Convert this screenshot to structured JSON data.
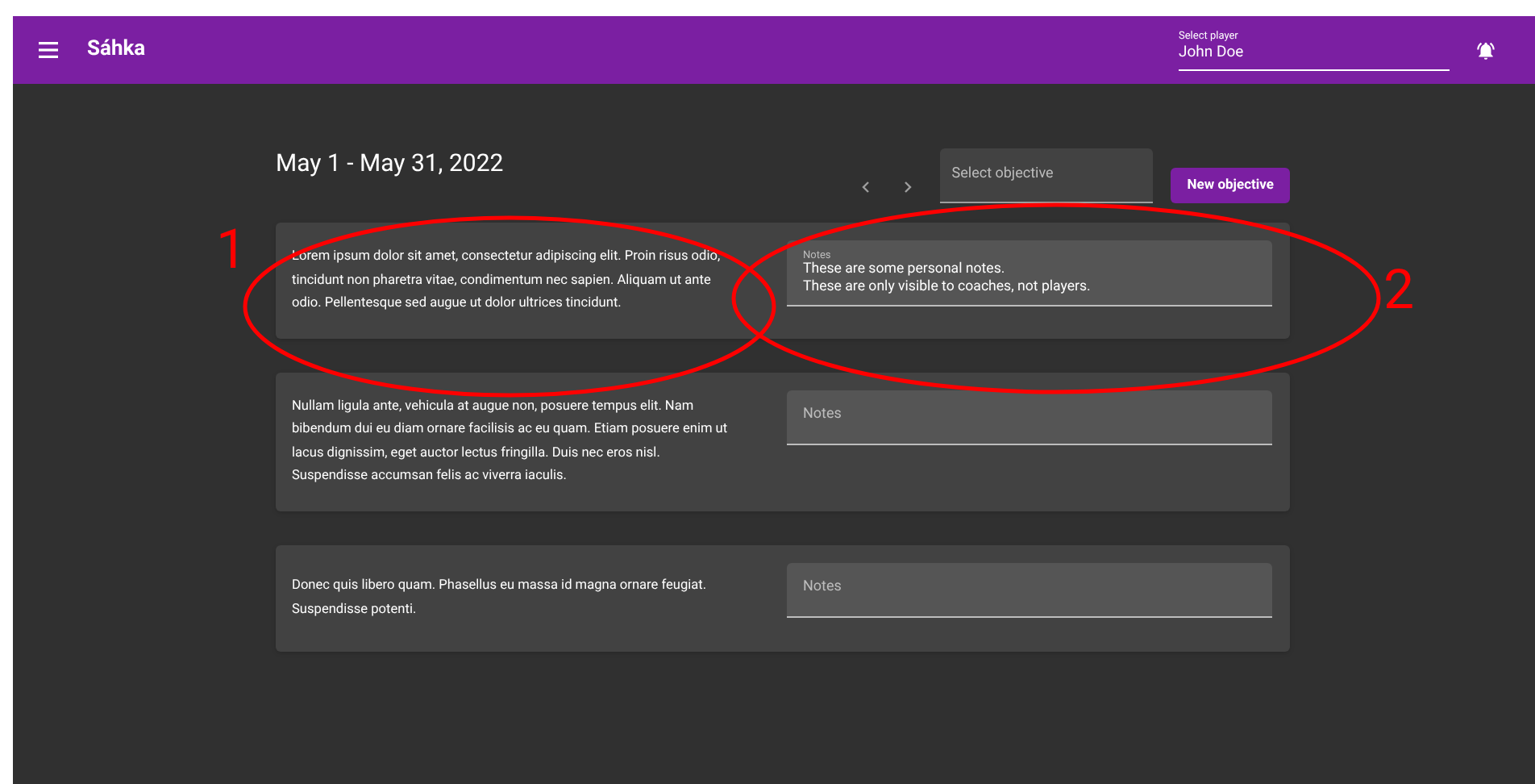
{
  "app_bar": {
    "title": "Sáhka",
    "player_select": {
      "label": "Select player",
      "value": "John Doe"
    }
  },
  "toolbar": {
    "date_range": "May 1 - May 31, 2022",
    "objective_select": {
      "placeholder": "Select objective"
    },
    "new_button": "New objective"
  },
  "objectives": [
    {
      "text": "Lorem ipsum dolor sit amet, consectetur adipiscing elit. Proin risus odio, tincidunt non pharetra vitae, condimentum nec sapien. Aliquam ut ante odio. Pellentesque sed augue ut dolor ultrices tincidunt.",
      "notes": {
        "label": "Notes",
        "value": "These are some personal notes.\nThese are only visible to coaches, not players."
      }
    },
    {
      "text": "Nullam ligula ante, vehicula at augue non, posuere tempus elit. Nam bibendum dui eu diam ornare facilisis ac eu quam. Etiam posuere enim ut lacus dignissim, eget auctor lectus fringilla. Duis nec eros nisl. Suspendisse accumsan felis ac viverra iaculis.",
      "notes": {
        "placeholder": "Notes"
      }
    },
    {
      "text": "Donec quis libero quam. Phasellus eu massa id magna ornare feugiat. Suspendisse potenti.",
      "notes": {
        "placeholder": "Notes"
      }
    }
  ],
  "annotations": [
    {
      "label": "1"
    },
    {
      "label": "2"
    }
  ]
}
